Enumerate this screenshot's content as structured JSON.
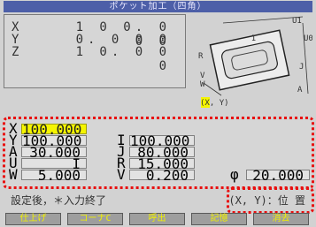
{
  "title": "ポケット加工（四角）",
  "coords": [
    {
      "axis": "X",
      "value": "1 0 0. 0 0 0"
    },
    {
      "axis": "Y",
      "value": "0. 0 0 0"
    },
    {
      "axis": "Z",
      "value": "1 0. 0 0 0"
    }
  ],
  "diagram": {
    "labels": {
      "u1": "U1",
      "u0": "U0",
      "r": "R",
      "v": "V",
      "w": "W",
      "i": "I",
      "j": "J",
      "a": "A",
      "x": "X",
      "y": "Y"
    }
  },
  "params_left": [
    {
      "label": "X",
      "value": "100.000",
      "active": true
    },
    {
      "label": "Y",
      "value": "100.000"
    },
    {
      "label": "A",
      "value": "30.000"
    },
    {
      "label": "U",
      "value": "I"
    },
    {
      "label": "W",
      "value": "5.000"
    }
  ],
  "params_mid": [
    {
      "label": "I",
      "value": "100.000"
    },
    {
      "label": "J",
      "value": "80.000"
    },
    {
      "label": "R",
      "value": "15.000"
    },
    {
      "label": "V",
      "value": "0.200"
    }
  ],
  "phi": {
    "label": "φ",
    "value": "20.000"
  },
  "message": "設定後，＊入力終了",
  "xy_hint": "(X, Y)：位 置",
  "softkeys": [
    "仕上げ",
    "コーナC",
    "呼出",
    "記憶",
    "消去"
  ],
  "colors": {
    "title_bg": "#4d5fa8",
    "active_field": "#f5f500",
    "dotted": "#e81010",
    "softkey_text": "#f0f000"
  }
}
